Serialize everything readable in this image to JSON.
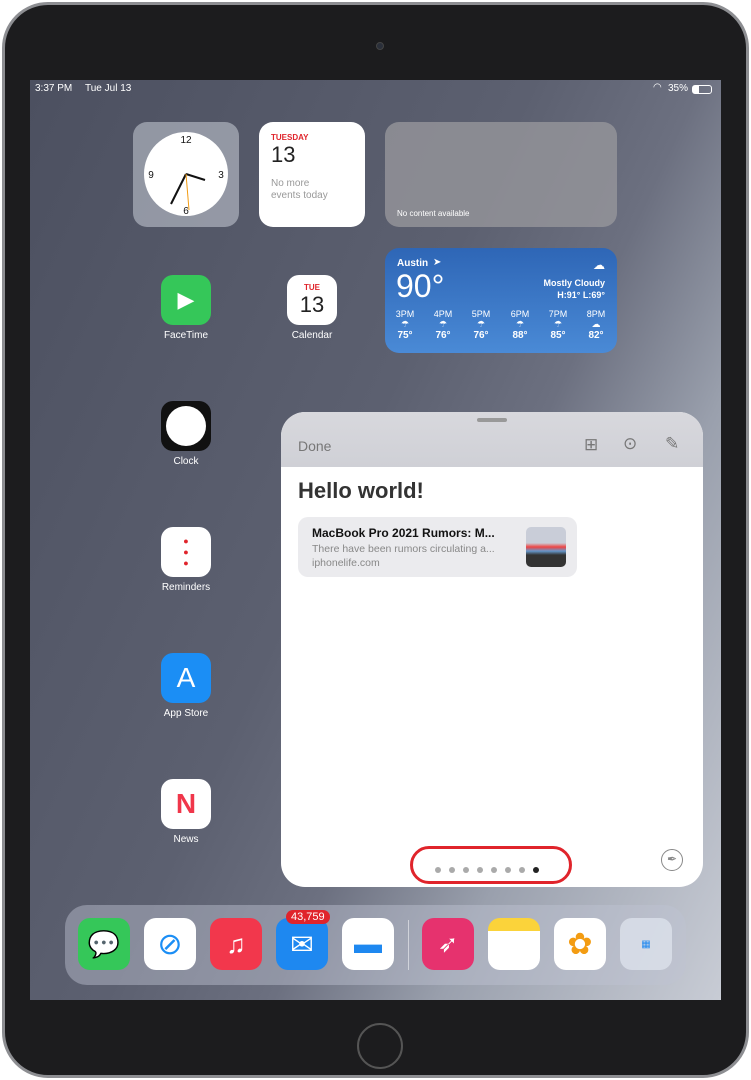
{
  "status": {
    "time": "3:37 PM",
    "date": "Tue Jul 13",
    "battery": "35%"
  },
  "widgets": {
    "calendar": {
      "day": "TUESDAY",
      "date": "13",
      "events": "No more events today"
    },
    "empty": {
      "text": "No content available"
    },
    "weather": {
      "city": "Austin",
      "temp": "90°",
      "condition": "Mostly Cloudy",
      "hilo": "H:91° L:69°",
      "hours": [
        {
          "t": "3PM",
          "v": "75°"
        },
        {
          "t": "4PM",
          "v": "76°"
        },
        {
          "t": "5PM",
          "v": "76°"
        },
        {
          "t": "6PM",
          "v": "88°"
        },
        {
          "t": "7PM",
          "v": "85°"
        },
        {
          "t": "8PM",
          "v": "82°"
        }
      ]
    }
  },
  "apps": {
    "facetime": "FaceTime",
    "calendar": "Calendar",
    "calendar_day": "TUE",
    "calendar_date": "13",
    "clock": "Clock",
    "reminders": "Reminders",
    "appstore": "App Store",
    "news": "News"
  },
  "notes": {
    "done": "Done",
    "title": "Hello world!",
    "link": {
      "title": "MacBook Pro 2021 Rumors: M...",
      "desc": "There have been rumors circulating a...",
      "site": "iphonelife.com"
    },
    "page_count": 8,
    "current_page": 8
  },
  "dock": {
    "mail_badge": "43,759"
  },
  "colors": {
    "accent_red": "#e0242b",
    "weather_blue": "#2f6fc0"
  }
}
